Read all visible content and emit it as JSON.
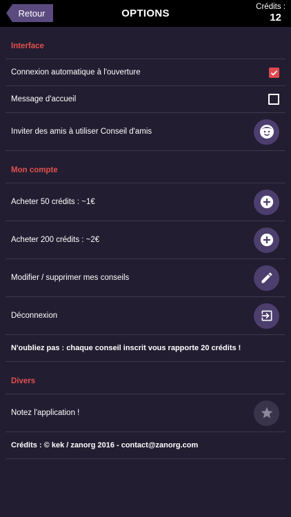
{
  "header": {
    "back_label": "Retour",
    "title": "OPTIONS",
    "credits_label": "Crédits :",
    "credits_value": "12"
  },
  "sections": {
    "interface": {
      "title": "Interface",
      "auto_connect_label": "Connexion automatique à l'ouverture",
      "auto_connect_checked": true,
      "welcome_label": "Message d'accueil",
      "welcome_checked": false,
      "invite_label": "Inviter des amis à utiliser Conseil d'amis"
    },
    "account": {
      "title": "Mon compte",
      "buy50_label": "Acheter 50 crédits : ~1€",
      "buy200_label": "Acheter 200 crédits : ~2€",
      "edit_label": "Modifier / supprimer mes conseils",
      "logout_label": "Déconnexion",
      "reminder": "N'oubliez pas : chaque conseil inscrit vous rapporte 20 crédits !"
    },
    "misc": {
      "title": "Divers",
      "rate_label": "Notez l'application !",
      "credits_footer": "Crédits : © kek / zanorg 2016 - contact@zanorg.com"
    }
  },
  "colors": {
    "background": "#221d30",
    "accent_red": "#e2504f",
    "button_purple": "#4c3f6e",
    "back_button": "#5b4a7f"
  },
  "icons": {
    "invite": "smiley-face-icon",
    "buy50": "plus-icon",
    "buy200": "plus-icon",
    "edit": "pencil-icon",
    "logout": "exit-icon",
    "rate": "star-icon"
  }
}
